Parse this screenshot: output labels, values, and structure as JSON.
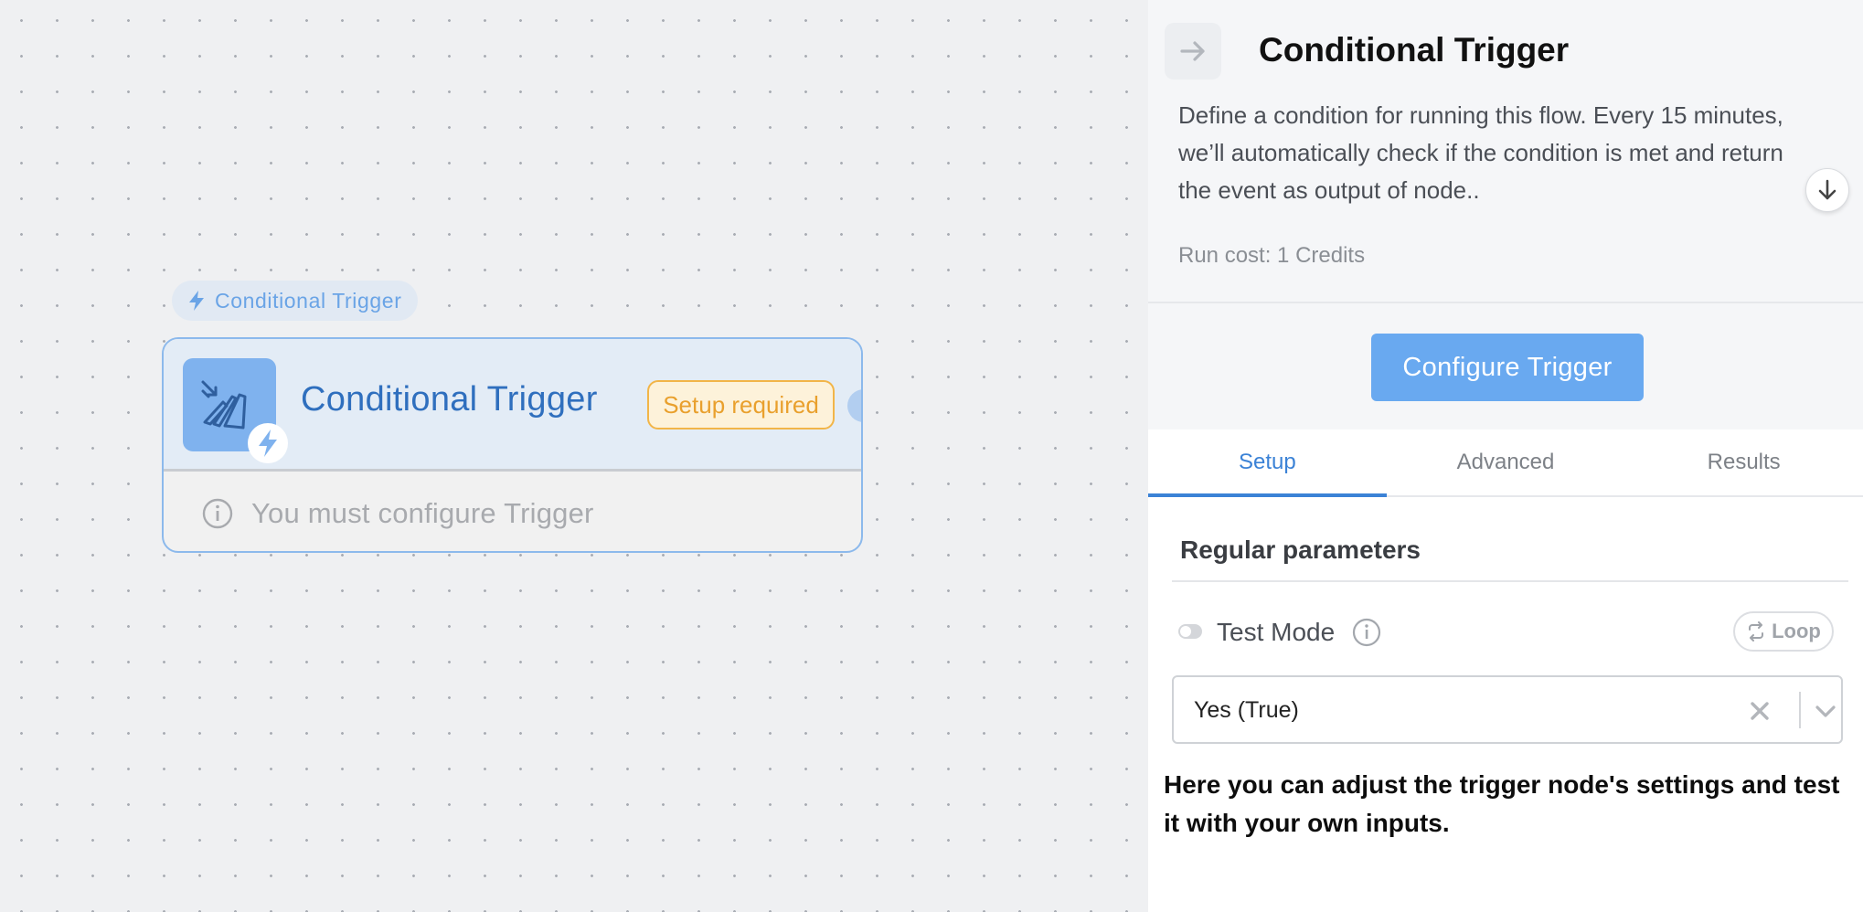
{
  "canvas": {
    "node_tag_label": "Conditional Trigger",
    "node": {
      "title": "Conditional Trigger",
      "status_badge": "Setup required",
      "message": "You must configure Trigger"
    }
  },
  "panel": {
    "title": "Conditional Trigger",
    "description": "Define a condition for running this flow. Every 15 minutes, we’ll automatically check if the condition is met and return the event as output of node..",
    "run_cost": "Run cost: 1 Credits",
    "configure_button": "Configure Trigger",
    "tabs": [
      {
        "label": "Setup",
        "active": true
      },
      {
        "label": "Advanced",
        "active": false
      },
      {
        "label": "Results",
        "active": false
      }
    ],
    "section_title": "Regular parameters",
    "test_mode": {
      "label": "Test Mode",
      "loop_label": "Loop",
      "selected_value": "Yes (True)"
    },
    "tip": "Here you can adjust the trigger node's settings and test it with your own inputs."
  },
  "colors": {
    "accent": "#3b82d6",
    "button": "#69a9f0",
    "warning": "#f2b548",
    "node_icon": "#7fb2ee"
  },
  "icons": [
    "bolt-icon",
    "trigger-glyph-icon",
    "info-icon",
    "arrow-right-icon",
    "arrow-down-icon",
    "loop-icon",
    "clear-icon",
    "chevron-down-icon"
  ]
}
